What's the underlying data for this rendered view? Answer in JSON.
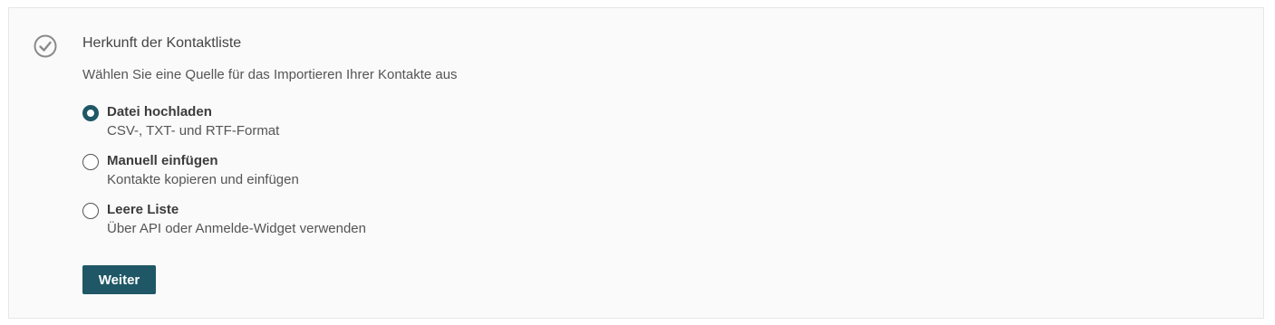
{
  "section": {
    "title": "Herkunft der Kontaktliste",
    "subtitle": "Wählen Sie eine Quelle für das Importieren Ihrer Kontakte aus",
    "status_icon": "check-circle-icon"
  },
  "options": [
    {
      "label": "Datei hochladen",
      "description": "CSV-, TXT- und RTF-Format",
      "selected": true
    },
    {
      "label": "Manuell einfügen",
      "description": "Kontakte kopieren und einfügen",
      "selected": false
    },
    {
      "label": "Leere Liste",
      "description": "Über API oder Anmelde-Widget verwenden",
      "selected": false
    }
  ],
  "actions": {
    "next_label": "Weiter"
  },
  "colors": {
    "accent": "#1f5766",
    "panel_background": "#fafafa",
    "text": "#444444"
  }
}
